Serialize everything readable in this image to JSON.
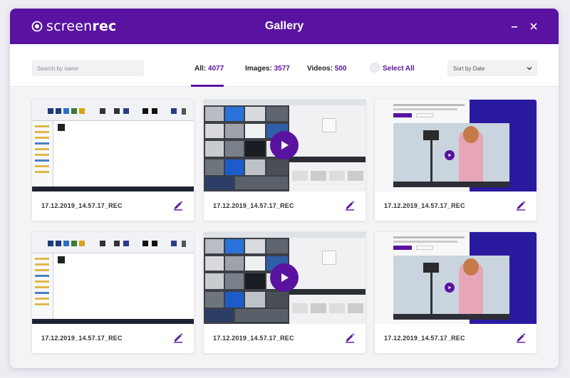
{
  "app": {
    "logo_light": "screen",
    "logo_bold": "rec",
    "title": "Gallery"
  },
  "toolbar": {
    "search_placeholder": "Search by name",
    "tabs": [
      {
        "label": "All: ",
        "count": "4077"
      },
      {
        "label": "Images: ",
        "count": "3577"
      },
      {
        "label": "Videos: ",
        "count": "500"
      }
    ],
    "select_all": "Select All",
    "sort": "Sort by Date"
  },
  "gallery": {
    "items": [
      {
        "name": "17.12.2019_14.57.17_REC",
        "thumb": "explorer"
      },
      {
        "name": "17.12.2019_14.57.17_REC",
        "thumb": "images"
      },
      {
        "name": "17.12.2019_14.57.17_REC",
        "thumb": "web"
      },
      {
        "name": "17.12.2019_14.57.17_REC",
        "thumb": "explorer"
      },
      {
        "name": "17.12.2019_14.57.17_REC",
        "thumb": "images"
      },
      {
        "name": "17.12.2019_14.57.17_REC",
        "thumb": "web"
      }
    ]
  },
  "colors": {
    "accent": "#5a13a0",
    "background": "#f4f4f6"
  },
  "icons": [
    "screenrec-logo-icon",
    "minimize-icon",
    "close-icon",
    "chevron-down-icon",
    "play-icon",
    "edit-pencil-icon"
  ]
}
